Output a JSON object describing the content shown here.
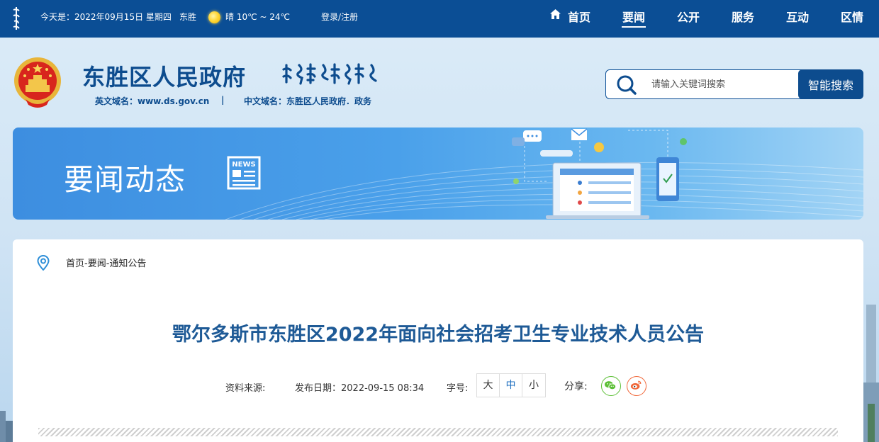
{
  "topbar": {
    "date_text": "今天是：2022年09月15日 星期四",
    "city": "东胜",
    "weather": "晴 10℃ ~ 24℃",
    "login": "登录/注册"
  },
  "nav": {
    "items": [
      {
        "label": "首页"
      },
      {
        "label": "要闻"
      },
      {
        "label": "公开"
      },
      {
        "label": "服务"
      },
      {
        "label": "互动"
      },
      {
        "label": "区情"
      }
    ],
    "active": "要闻"
  },
  "header": {
    "site_title": "东胜区人民政府",
    "en_domain": "英文域名：www.ds.gov.cn",
    "separator": "|",
    "cn_domain": "中文域名：东胜区人民政府．政务"
  },
  "search": {
    "placeholder": "请输入关键词搜索",
    "button_label": "智能搜索"
  },
  "banner": {
    "title": "要闻动态",
    "icon_text": "NEWS"
  },
  "breadcrumb": "首页-要闻-通知公告",
  "article": {
    "title": "鄂尔多斯市东胜区2022年面向社会招考卫生专业技术人员公告",
    "source_label": "资料来源:",
    "date_label": "发布日期：2022-09-15 08:34",
    "font_label": "字号:",
    "font_sizes": [
      "大",
      "中",
      "小"
    ],
    "font_current": "中",
    "share_label": "分享:"
  },
  "colors": {
    "topbar": "#0b4e95",
    "brand_blue": "#0d4c8e",
    "title_blue": "#1e5a96",
    "wechat": "#5cbf36",
    "weibo": "#f0683a"
  }
}
